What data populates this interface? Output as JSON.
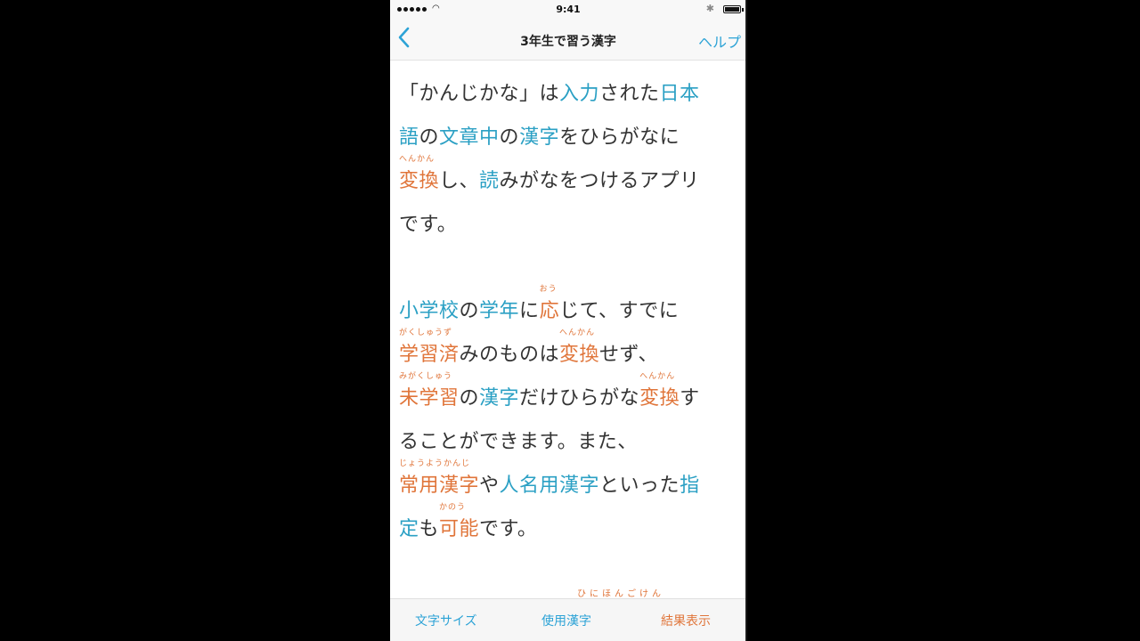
{
  "status": {
    "time": "9:41",
    "wifi": "wifi-icon",
    "bluetooth": "bluetooth-icon",
    "battery": "battery-icon"
  },
  "nav": {
    "back_icon": "chevron-left-icon",
    "title": "3年生で習う漢字",
    "help": "ヘルプ"
  },
  "colors": {
    "learned_kanji": "#2ba0c4",
    "unlearned_kanji": "#e0753a",
    "accent": "#2da3d6"
  },
  "paragraph1": [
    [
      {
        "t": "「かんじかな」は"
      },
      {
        "t": "入力",
        "c": "k"
      },
      {
        "t": "された"
      },
      {
        "t": "日本",
        "c": "k"
      }
    ],
    [
      {
        "t": "語",
        "c": "k"
      },
      {
        "t": "の"
      },
      {
        "t": "文章中",
        "c": "k"
      },
      {
        "t": "の"
      },
      {
        "t": "漢字",
        "c": "k"
      },
      {
        "t": "をひらがなに"
      }
    ],
    [
      {
        "t": "変換",
        "c": "u",
        "r": "へんかん"
      },
      {
        "t": "し、"
      },
      {
        "t": "読",
        "c": "k"
      },
      {
        "t": "みがなをつけるアプリ"
      }
    ],
    [
      {
        "t": "です。"
      }
    ]
  ],
  "paragraph2": [
    [
      {
        "t": "小学校",
        "c": "k"
      },
      {
        "t": "の"
      },
      {
        "t": "学年",
        "c": "k"
      },
      {
        "t": "に"
      },
      {
        "t": "応",
        "c": "u",
        "r": "おう"
      },
      {
        "t": "じて、すでに"
      }
    ],
    [
      {
        "t": "学習済",
        "c": "u",
        "r": "がくしゅうず"
      },
      {
        "t": "みのものは"
      },
      {
        "t": "変換",
        "c": "u",
        "r": "へんかん"
      },
      {
        "t": "せず、"
      }
    ],
    [
      {
        "t": "未学習",
        "c": "u",
        "r": "みがくしゅう"
      },
      {
        "t": "の"
      },
      {
        "t": "漢字",
        "c": "k"
      },
      {
        "t": "だけひらがな"
      },
      {
        "t": "変換",
        "c": "u",
        "r": "へんかん"
      },
      {
        "t": "す"
      }
    ],
    [
      {
        "t": "ることができます。また、"
      }
    ],
    [
      {
        "t": "常用漢字",
        "c": "u",
        "r": "じょうようかんじ"
      },
      {
        "t": "や"
      },
      {
        "t": "人名用漢字",
        "c": "k"
      },
      {
        "t": "といった"
      },
      {
        "t": "指",
        "c": "k"
      }
    ],
    [
      {
        "t": "定",
        "c": "k"
      },
      {
        "t": "も"
      },
      {
        "t": "可能",
        "c": "u",
        "r": "かのう"
      },
      {
        "t": "です。"
      }
    ]
  ],
  "peek_ruby": "ひにほんごけん",
  "tabs": {
    "font_size": "文字サイズ",
    "used_kanji": "使用漢字",
    "show_result": "結果表示"
  }
}
